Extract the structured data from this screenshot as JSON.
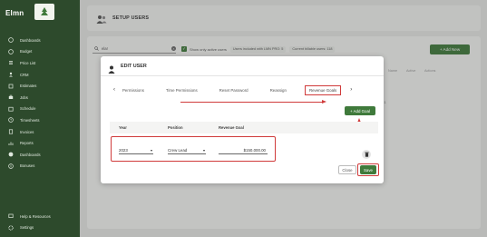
{
  "brand": {
    "name": "Elmn"
  },
  "sidebar": {
    "items": [
      {
        "label": "Dashboards",
        "icon": "dashboard-icon"
      },
      {
        "label": "Budget",
        "icon": "dollar-icon"
      },
      {
        "label": "Price List",
        "icon": "list-icon"
      },
      {
        "label": "CRM",
        "icon": "person-icon"
      },
      {
        "label": "Estimates",
        "icon": "estimate-icon"
      },
      {
        "label": "Jobs",
        "icon": "briefcase-icon"
      },
      {
        "label": "Schedule",
        "icon": "calendar-icon"
      },
      {
        "label": "Timesheets",
        "icon": "clock-icon"
      },
      {
        "label": "Invoices",
        "icon": "invoice-icon"
      },
      {
        "label": "Reports",
        "icon": "report-icon"
      },
      {
        "label": "Dashboards",
        "icon": "gauge-icon"
      },
      {
        "label": "Bonuses",
        "icon": "bonus-icon"
      }
    ],
    "bottom": [
      {
        "label": "Help & Resources",
        "icon": "help-icon"
      },
      {
        "label": "Settings",
        "icon": "gear-icon"
      }
    ]
  },
  "header": {
    "title": "SETUP USERS"
  },
  "filters": {
    "search_value": "elar",
    "active_only_label": "Show only active users",
    "chip1": "Users included with LMN PRO: 5",
    "chip2": "Current billable users: 118",
    "add_new_label": "+  Add New"
  },
  "grid": {
    "columns": [
      "Name",
      "Active",
      "Actions"
    ],
    "pager": "1-1 of 1"
  },
  "modal": {
    "title": "EDIT USER",
    "tabs": [
      "Permissions",
      "Time Permissions",
      "Reset Password",
      "Reassign",
      "Revenue Goals"
    ],
    "active_tab": "Revenue Goals",
    "add_goal_label": "+  Add Goal",
    "columns": {
      "year": "Year",
      "position": "Position",
      "goal": "Revenue Goal"
    },
    "row": {
      "year": "2023",
      "position": "Crew Lead",
      "goal": "$150,000.00"
    },
    "close_label": "Close",
    "save_label": "Save"
  },
  "colors": {
    "sidebar": "#2d4a2c",
    "accent": "#3f7a3b",
    "highlight": "#d03b3b"
  }
}
